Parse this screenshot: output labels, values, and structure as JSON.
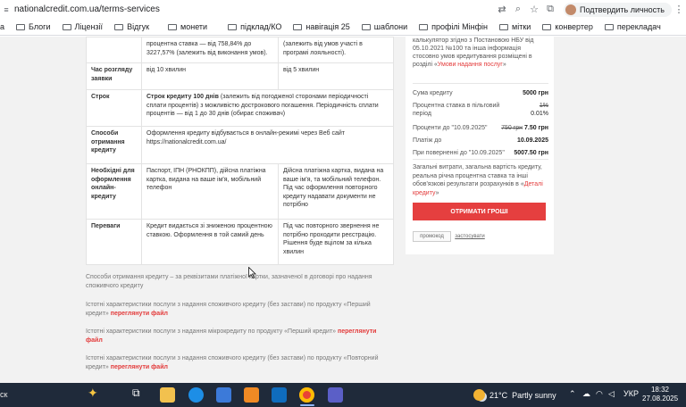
{
  "browser": {
    "url": "nationalcredit.com.ua/terms-services",
    "profile_label": "Подтвердить личность",
    "bookmarks": [
      "a",
      "Блоги",
      "Ліцензії",
      "Відгук",
      "монети",
      "підклад/КО",
      "навігація 25",
      "шаблони",
      "профілі Мінфін",
      "мітки",
      "конвертер",
      "перекладач"
    ]
  },
  "table": {
    "top_row": {
      "c1": "процентна ставка — від 758,84% до 3227,57% (залежить від виконання умов).",
      "c2": "(залежить від умов участі в програмі лояльності)."
    },
    "review": {
      "label": "Час розгляду заявки",
      "c1": "від 10 хвилин",
      "c2": "від 5 хвилин"
    },
    "term": {
      "label": "Строк",
      "bold": "Строк кредиту 100 днів",
      "text": " (залежить від погодженої сторонами періодичності сплати процентів) з можливістю дострокового погашення. Періодичність сплати процентів — від 1 до 30 днів (обирає споживач)"
    },
    "methods": {
      "label": "Способи отримання кредиту",
      "text": "Оформлення кредиту відбувається в онлайн-режимі через Веб сайт https://nationalcredit.com.ua/"
    },
    "documents": {
      "label": "Необхідні для оформлення онлайн-кредиту",
      "c1": "Паспорт, ІПН (РНОКПП), дійсна платіжна картка, видана на ваше ім'я, мобільний телефон",
      "c2": "Дійсна платіжна картка, видана на ваше ім'я, та мобільний телефон. Під час оформлення повторного кредиту надавати документи не потрібно"
    },
    "advantages": {
      "label": "Переваги",
      "c1": "Кредит видається зі зниженою процентною ставкою. Оформлення в той самий день",
      "c2": "Під час повторного звернення не потрібно проходити реєстрацію. Рішення буде вцілом за кілька хвилин"
    }
  },
  "sidebar": {
    "intro_text": "калькулятор згідно з Постановою НБУ від 05.10.2021 №100 та інша інформація стосовно умов кредитування розміщені в розділі «",
    "intro_link": "Умови надання послуг",
    "intro_end": "»",
    "rows": [
      {
        "label": "Сума кредиту",
        "value": "5000 грн"
      },
      {
        "label": "Процентна ставка в пільговий період",
        "value_old": "1%",
        "value": "0.01%"
      },
      {
        "label": "Проценти до \"10.09.2025\"",
        "value_old": "750 грн",
        "value": "7.50 грн"
      },
      {
        "label": "Платіж до",
        "value": "10.09.2025"
      },
      {
        "label": "При поверненні до \"10.09.2025\"",
        "value": "5007.50 грн"
      }
    ],
    "note_text": "Загальні витрати, загальна вартість кредиту, реальна річна процентна ставка та інші обов'язкові результати розрахунків в «",
    "note_link": "Деталі кредиту",
    "note_end": "»",
    "button": "ОТРИМАТИ ГРОШІ",
    "mini1": "промокод",
    "mini2": "застосувати"
  },
  "paragraphs": [
    {
      "text": "Способи отримання кредиту – за реквізитами платіжної картки, зазначеної в договорі про надання споживчого кредиту",
      "link": ""
    },
    {
      "text": "Істотні характеристики послуги з надання споживчого кредиту (без застави) по продукту «Перший кредит» ",
      "link": "переглянути файл"
    },
    {
      "text": "Істотні характеристики послуги з надання мікрокредиту по продукту «Перший кредит» ",
      "link": "переглянути файл"
    },
    {
      "text": "Істотні характеристики послуги з надання споживчого кредиту (без застави) по продукту «Повторний кредит» ",
      "link": "переглянути файл"
    }
  ],
  "taskbar": {
    "search_label": "ск",
    "weather_temp": "21°C",
    "weather_text": "Partly sunny",
    "lang": "УКР",
    "time": "18:32",
    "date": "27.08.2025"
  }
}
